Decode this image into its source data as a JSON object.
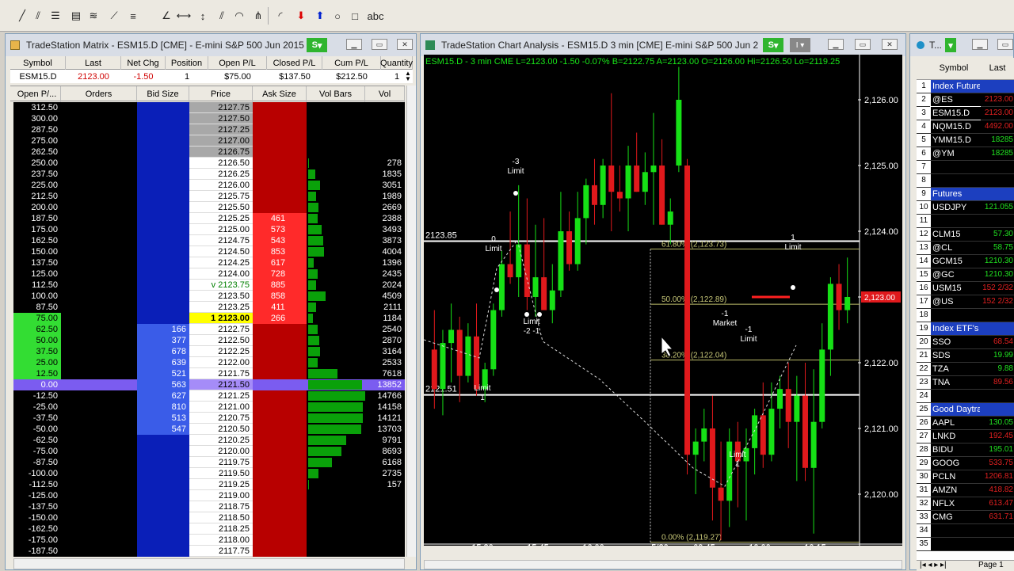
{
  "toolbar": {
    "icons": [
      "trendline-icon",
      "parallel-lines-icon",
      "horizontal-lines-icon",
      "fib-icon",
      "gann-fan-icon",
      "speed-lines-icon",
      "fib-bars-icon",
      "angle-icon",
      "horizontal-line-icon",
      "vertical-line-icon",
      "channel-icon",
      "cycle-icon",
      "pitchfork-icon",
      "arc-icon",
      "sell-arrow-icon",
      "buy-arrow-icon",
      "ellipse-icon",
      "rectangle-icon"
    ],
    "text_tool": "abc"
  },
  "matrix": {
    "title": "TradeStation Matrix - ESM15.D [CME] - E-mini S&P 500 Jun 2015",
    "s_button": "S",
    "position_headers": [
      "Symbol",
      "Last",
      "Net Chg",
      "Position",
      "Open P/L",
      "Closed P/L",
      "Cum P/L",
      "Quantity"
    ],
    "position_row": [
      "ESM15.D",
      "2123.00",
      "-1.50",
      "1",
      "$75.00",
      "$137.50",
      "$212.50",
      "1"
    ],
    "headers": [
      "Open P/...",
      "Orders",
      "Bid Size",
      "Price",
      "Ask Size",
      "Vol Bars",
      "Vol"
    ],
    "rows": [
      {
        "pl": "312.50",
        "bid": "",
        "price": "2127.75",
        "ask": "",
        "vol": ""
      },
      {
        "pl": "300.00",
        "bid": "",
        "price": "2127.50",
        "ask": "",
        "vol": ""
      },
      {
        "pl": "287.50",
        "bid": "",
        "price": "2127.25",
        "ask": "",
        "vol": ""
      },
      {
        "pl": "275.00",
        "bid": "",
        "price": "2127.00",
        "ask": "",
        "vol": ""
      },
      {
        "pl": "262.50",
        "bid": "",
        "price": "2126.75",
        "ask": "",
        "vol": ""
      },
      {
        "pl": "250.00",
        "bid": "",
        "price": "2126.50",
        "ask": "",
        "vol": "278"
      },
      {
        "pl": "237.50",
        "bid": "",
        "price": "2126.25",
        "ask": "",
        "vol": "1835"
      },
      {
        "pl": "225.00",
        "bid": "",
        "price": "2126.00",
        "ask": "",
        "vol": "3051"
      },
      {
        "pl": "212.50",
        "bid": "",
        "price": "2125.75",
        "ask": "",
        "vol": "1989"
      },
      {
        "pl": "200.00",
        "bid": "",
        "price": "2125.50",
        "ask": "",
        "vol": "2669"
      },
      {
        "pl": "187.50",
        "bid": "",
        "price": "2125.25",
        "ask": "461",
        "vol": "2388"
      },
      {
        "pl": "175.00",
        "bid": "",
        "price": "2125.00",
        "ask": "573",
        "vol": "3493"
      },
      {
        "pl": "162.50",
        "bid": "",
        "price": "2124.75",
        "ask": "543",
        "vol": "3873"
      },
      {
        "pl": "150.00",
        "bid": "",
        "price": "2124.50",
        "ask": "853",
        "vol": "4004"
      },
      {
        "pl": "137.50",
        "bid": "",
        "price": "2124.25",
        "ask": "617",
        "vol": "1396"
      },
      {
        "pl": "125.00",
        "bid": "",
        "price": "2124.00",
        "ask": "728",
        "vol": "2435"
      },
      {
        "pl": "112.50",
        "bid": "",
        "price": "v 2123.75",
        "ask": "885",
        "vol": "2024"
      },
      {
        "pl": "100.00",
        "bid": "",
        "price": "2123.50",
        "ask": "858",
        "vol": "4509"
      },
      {
        "pl": "87.50",
        "bid": "",
        "price": "2123.25",
        "ask": "411",
        "vol": "2111"
      },
      {
        "pl": "75.00",
        "bid": "",
        "price": "1   2123.00",
        "ask": "266",
        "vol": "1184"
      },
      {
        "pl": "62.50",
        "bid": "166",
        "price": "2122.75",
        "ask": "",
        "vol": "2540"
      },
      {
        "pl": "50.00",
        "bid": "377",
        "price": "2122.50",
        "ask": "",
        "vol": "2870"
      },
      {
        "pl": "37.50",
        "bid": "678",
        "price": "2122.25",
        "ask": "",
        "vol": "3164"
      },
      {
        "pl": "25.00",
        "bid": "639",
        "price": "2122.00",
        "ask": "",
        "vol": "2533"
      },
      {
        "pl": "12.50",
        "bid": "521",
        "price": "2121.75",
        "ask": "",
        "vol": "7618"
      },
      {
        "pl": "0.00",
        "bid": "563",
        "price": "2121.50",
        "ask": "",
        "vol": "13852"
      },
      {
        "pl": "-12.50",
        "bid": "627",
        "price": "2121.25",
        "ask": "",
        "vol": "14766"
      },
      {
        "pl": "-25.00",
        "bid": "810",
        "price": "2121.00",
        "ask": "",
        "vol": "14158"
      },
      {
        "pl": "-37.50",
        "bid": "513",
        "price": "2120.75",
        "ask": "",
        "vol": "14121"
      },
      {
        "pl": "-50.00",
        "bid": "547",
        "price": "2120.50",
        "ask": "",
        "vol": "13703"
      },
      {
        "pl": "-62.50",
        "bid": "",
        "price": "2120.25",
        "ask": "",
        "vol": "9791"
      },
      {
        "pl": "-75.00",
        "bid": "",
        "price": "2120.00",
        "ask": "",
        "vol": "8693"
      },
      {
        "pl": "-87.50",
        "bid": "",
        "price": "2119.75",
        "ask": "",
        "vol": "6168"
      },
      {
        "pl": "-100.00",
        "bid": "",
        "price": "2119.50",
        "ask": "",
        "vol": "2735"
      },
      {
        "pl": "-112.50",
        "bid": "",
        "price": "2119.25",
        "ask": "",
        "vol": "157"
      },
      {
        "pl": "-125.00",
        "bid": "",
        "price": "2119.00",
        "ask": "",
        "vol": ""
      },
      {
        "pl": "-137.50",
        "bid": "",
        "price": "2118.75",
        "ask": "",
        "vol": ""
      },
      {
        "pl": "-150.00",
        "bid": "",
        "price": "2118.50",
        "ask": "",
        "vol": ""
      },
      {
        "pl": "-162.50",
        "bid": "",
        "price": "2118.25",
        "ask": "",
        "vol": ""
      },
      {
        "pl": "-175.00",
        "bid": "",
        "price": "2118.00",
        "ask": "",
        "vol": ""
      },
      {
        "pl": "-187.50",
        "bid": "",
        "price": "2117.75",
        "ask": "",
        "vol": ""
      }
    ]
  },
  "chart": {
    "title": "TradeStation Chart Analysis - ESM15.D 3 min [CME] E-mini S&P 500 Jun 2...",
    "s_button": "S",
    "info_bar": "ESM15.D - 3 min  CME  L=2123.00  -1.50  -0.07%  B=2122.75  A=2123.00  O=2126.00  Hi=2126.50  Lo=2119.25",
    "y_ticks": [
      "2,126.00",
      "2,125.00",
      "2,124.00",
      "2,123.00",
      "2,122.00",
      "2,121.00",
      "2,120.00"
    ],
    "x_ticks": [
      "15:30",
      "15:45",
      "16:00",
      "5/20",
      "09:45",
      "10:00",
      "10:15"
    ],
    "ylim": [
      2119.25,
      2126.5
    ],
    "hline_left_labels": [
      "2123.85",
      "2121.51"
    ],
    "fib_labels": [
      "61.80% (2,123.73)",
      "50.00% (2,122.89)",
      "38.20% (2,122.04)",
      "0.00% (2,119.27)"
    ],
    "current_price_tag": "2,123.00",
    "order_annotations": [
      {
        "top": "-3",
        "bottom": "Limit"
      },
      {
        "top": "0",
        "bottom": "Limit"
      },
      {
        "top": "Limit",
        "bottom": "-2  -1"
      },
      {
        "top": "Limit",
        "bottom": "1"
      },
      {
        "top": "-1",
        "bottom": "Market"
      },
      {
        "top": "-1",
        "bottom": "Limit"
      },
      {
        "top": "Limit",
        "bottom": "1"
      },
      {
        "top": "1",
        "bottom": "Limit"
      }
    ],
    "candles": [
      {
        "o": 2122.2,
        "h": 2122.8,
        "l": 2121.3,
        "c": 2121.6
      },
      {
        "o": 2121.6,
        "h": 2122.5,
        "l": 2121.2,
        "c": 2122.3
      },
      {
        "o": 2122.3,
        "h": 2122.9,
        "l": 2121.7,
        "c": 2122.5
      },
      {
        "o": 2122.5,
        "h": 2122.7,
        "l": 2121.4,
        "c": 2121.8
      },
      {
        "o": 2121.8,
        "h": 2122.6,
        "l": 2121.7,
        "c": 2122.4
      },
      {
        "o": 2122.4,
        "h": 2122.9,
        "l": 2121.5,
        "c": 2121.6
      },
      {
        "o": 2121.6,
        "h": 2122.0,
        "l": 2121.4,
        "c": 2121.9
      },
      {
        "o": 2121.9,
        "h": 2122.9,
        "l": 2121.8,
        "c": 2122.8
      },
      {
        "o": 2122.8,
        "h": 2123.7,
        "l": 2122.7,
        "c": 2123.5
      },
      {
        "o": 2123.5,
        "h": 2124.3,
        "l": 2123.2,
        "c": 2123.3
      },
      {
        "o": 2123.3,
        "h": 2124.7,
        "l": 2123.0,
        "c": 2123.8
      },
      {
        "o": 2123.8,
        "h": 2124.5,
        "l": 2122.8,
        "c": 2123.0
      },
      {
        "o": 2123.0,
        "h": 2124.1,
        "l": 2122.7,
        "c": 2123.3
      },
      {
        "o": 2123.3,
        "h": 2124.2,
        "l": 2122.9,
        "c": 2122.8
      },
      {
        "o": 2122.8,
        "h": 2123.5,
        "l": 2122.6,
        "c": 2123.1
      },
      {
        "o": 2123.1,
        "h": 2124.6,
        "l": 2123.0,
        "c": 2124.0
      },
      {
        "o": 2124.0,
        "h": 2124.3,
        "l": 2123.4,
        "c": 2123.5
      },
      {
        "o": 2123.5,
        "h": 2124.6,
        "l": 2123.4,
        "c": 2124.2
      },
      {
        "o": 2124.2,
        "h": 2124.8,
        "l": 2123.8,
        "c": 2124.7
      },
      {
        "o": 2124.7,
        "h": 2125.1,
        "l": 2124.1,
        "c": 2124.4
      },
      {
        "o": 2124.4,
        "h": 2125.1,
        "l": 2124.2,
        "c": 2125.0
      },
      {
        "o": 2125.0,
        "h": 2126.1,
        "l": 2124.0,
        "c": 2124.6
      },
      {
        "o": 2124.6,
        "h": 2125.0,
        "l": 2124.3,
        "c": 2124.5
      },
      {
        "o": 2124.5,
        "h": 2125.3,
        "l": 2124.0,
        "c": 2125.0
      },
      {
        "o": 2125.0,
        "h": 2125.5,
        "l": 2124.6,
        "c": 2124.6
      },
      {
        "o": 2124.6,
        "h": 2125.2,
        "l": 2124.4,
        "c": 2124.9
      },
      {
        "o": 2124.9,
        "h": 2125.8,
        "l": 2124.1,
        "c": 2125.0
      },
      {
        "o": 2125.0,
        "h": 2125.4,
        "l": 2124.1,
        "c": 2124.1
      },
      {
        "o": 2124.1,
        "h": 2124.5,
        "l": 2123.8,
        "c": 2124.3
      },
      {
        "o": 2125.0,
        "h": 2126.5,
        "l": 2124.9,
        "c": 2126.0
      },
      {
        "o": 2125.0,
        "h": 2125.1,
        "l": 2120.3,
        "c": 2120.6
      },
      {
        "o": 2120.6,
        "h": 2121.0,
        "l": 2120.0,
        "c": 2120.8
      },
      {
        "o": 2120.8,
        "h": 2121.3,
        "l": 2120.5,
        "c": 2121.0
      },
      {
        "o": 2121.0,
        "h": 2121.5,
        "l": 2119.6,
        "c": 2120.1
      },
      {
        "o": 2120.1,
        "h": 2120.8,
        "l": 2119.3,
        "c": 2119.9
      },
      {
        "o": 2119.9,
        "h": 2121.0,
        "l": 2119.5,
        "c": 2120.8
      },
      {
        "o": 2120.8,
        "h": 2121.1,
        "l": 2119.8,
        "c": 2120.5
      },
      {
        "o": 2120.5,
        "h": 2121.0,
        "l": 2119.6,
        "c": 2120.7
      },
      {
        "o": 2120.7,
        "h": 2121.3,
        "l": 2120.3,
        "c": 2121.2
      },
      {
        "o": 2121.2,
        "h": 2121.7,
        "l": 2120.4,
        "c": 2120.6
      },
      {
        "o": 2120.6,
        "h": 2121.7,
        "l": 2120.5,
        "c": 2121.3
      },
      {
        "o": 2121.3,
        "h": 2121.8,
        "l": 2121.0,
        "c": 2121.6
      },
      {
        "o": 2121.6,
        "h": 2122.0,
        "l": 2120.7,
        "c": 2121.1
      },
      {
        "o": 2121.1,
        "h": 2121.8,
        "l": 2120.2,
        "c": 2121.5
      },
      {
        "o": 2121.5,
        "h": 2122.0,
        "l": 2120.2,
        "c": 2120.4
      },
      {
        "o": 2120.4,
        "h": 2121.9,
        "l": 2119.4,
        "c": 2121.1
      },
      {
        "o": 2121.1,
        "h": 2122.6,
        "l": 2121.0,
        "c": 2122.2
      },
      {
        "o": 2122.2,
        "h": 2123.3,
        "l": 2121.8,
        "c": 2123.2
      },
      {
        "o": 2123.2,
        "h": 2123.5,
        "l": 2122.5,
        "c": 2122.8
      },
      {
        "o": 2122.8,
        "h": 2123.6,
        "l": 2122.6,
        "c": 2123.0
      }
    ]
  },
  "radar": {
    "title": "T...",
    "headers": [
      "Symbol",
      "Last"
    ],
    "rows": [
      {
        "n": "1",
        "sym": "Index Futures",
        "last": "",
        "kind": "group"
      },
      {
        "n": "2",
        "sym": "@ES",
        "last": "2123.00",
        "kind": "down"
      },
      {
        "n": "3",
        "sym": "ESM15.D",
        "last": "2123.00",
        "kind": "down"
      },
      {
        "n": "4",
        "sym": "NQM15.D",
        "last": "4492.00",
        "kind": "down"
      },
      {
        "n": "5",
        "sym": "YMM15.D",
        "last": "18285",
        "kind": "up"
      },
      {
        "n": "6",
        "sym": "@YM",
        "last": "18285",
        "kind": "up"
      },
      {
        "n": "7",
        "sym": "",
        "last": "",
        "kind": "blank"
      },
      {
        "n": "8",
        "sym": "",
        "last": "",
        "kind": "blank"
      },
      {
        "n": "9",
        "sym": "Futures",
        "last": "",
        "kind": "group"
      },
      {
        "n": "10",
        "sym": "USDJPY",
        "last": "121.055",
        "kind": "up"
      },
      {
        "n": "11",
        "sym": "",
        "last": "",
        "kind": "blank"
      },
      {
        "n": "12",
        "sym": "CLM15",
        "last": "57.30",
        "kind": "up"
      },
      {
        "n": "13",
        "sym": "@CL",
        "last": "58.75",
        "kind": "up"
      },
      {
        "n": "14",
        "sym": "GCM15",
        "last": "1210.30",
        "kind": "up"
      },
      {
        "n": "15",
        "sym": "@GC",
        "last": "1210.30",
        "kind": "up"
      },
      {
        "n": "16",
        "sym": "USM15",
        "last": "152 2/32",
        "kind": "down"
      },
      {
        "n": "17",
        "sym": "@US",
        "last": "152 2/32",
        "kind": "down"
      },
      {
        "n": "18",
        "sym": "",
        "last": "",
        "kind": "blank"
      },
      {
        "n": "19",
        "sym": "Index ETF's",
        "last": "",
        "kind": "group"
      },
      {
        "n": "20",
        "sym": "SSO",
        "last": "68.54",
        "kind": "down"
      },
      {
        "n": "21",
        "sym": "SDS",
        "last": "19.99",
        "kind": "up"
      },
      {
        "n": "22",
        "sym": "TZA",
        "last": "9.88",
        "kind": "up"
      },
      {
        "n": "23",
        "sym": "TNA",
        "last": "89.56",
        "kind": "down"
      },
      {
        "n": "24",
        "sym": "",
        "last": "",
        "kind": "blank"
      },
      {
        "n": "25",
        "sym": "Good Daytrading Stocks",
        "last": "",
        "kind": "group"
      },
      {
        "n": "26",
        "sym": "AAPL",
        "last": "130.05",
        "kind": "up"
      },
      {
        "n": "27",
        "sym": "LNKD",
        "last": "192.45",
        "kind": "down"
      },
      {
        "n": "28",
        "sym": "BIDU",
        "last": "195.01",
        "kind": "up"
      },
      {
        "n": "29",
        "sym": "GOOG",
        "last": "533.75",
        "kind": "down"
      },
      {
        "n": "30",
        "sym": "PCLN",
        "last": "1206.81",
        "kind": "down"
      },
      {
        "n": "31",
        "sym": "AMZN",
        "last": "418.82",
        "kind": "down"
      },
      {
        "n": "32",
        "sym": "NFLX",
        "last": "613.47",
        "kind": "down"
      },
      {
        "n": "33",
        "sym": "CMG",
        "last": "631.71",
        "kind": "down"
      },
      {
        "n": "34",
        "sym": "",
        "last": "",
        "kind": "blank"
      },
      {
        "n": "35",
        "sym": "",
        "last": "",
        "kind": "blank"
      }
    ],
    "page_label": "Page 1"
  },
  "colors": {
    "bid": "#0a1fb8",
    "ask": "#b80000",
    "bull": "#16e016",
    "bear": "#e0191c",
    "bg_dark": "#000000"
  }
}
